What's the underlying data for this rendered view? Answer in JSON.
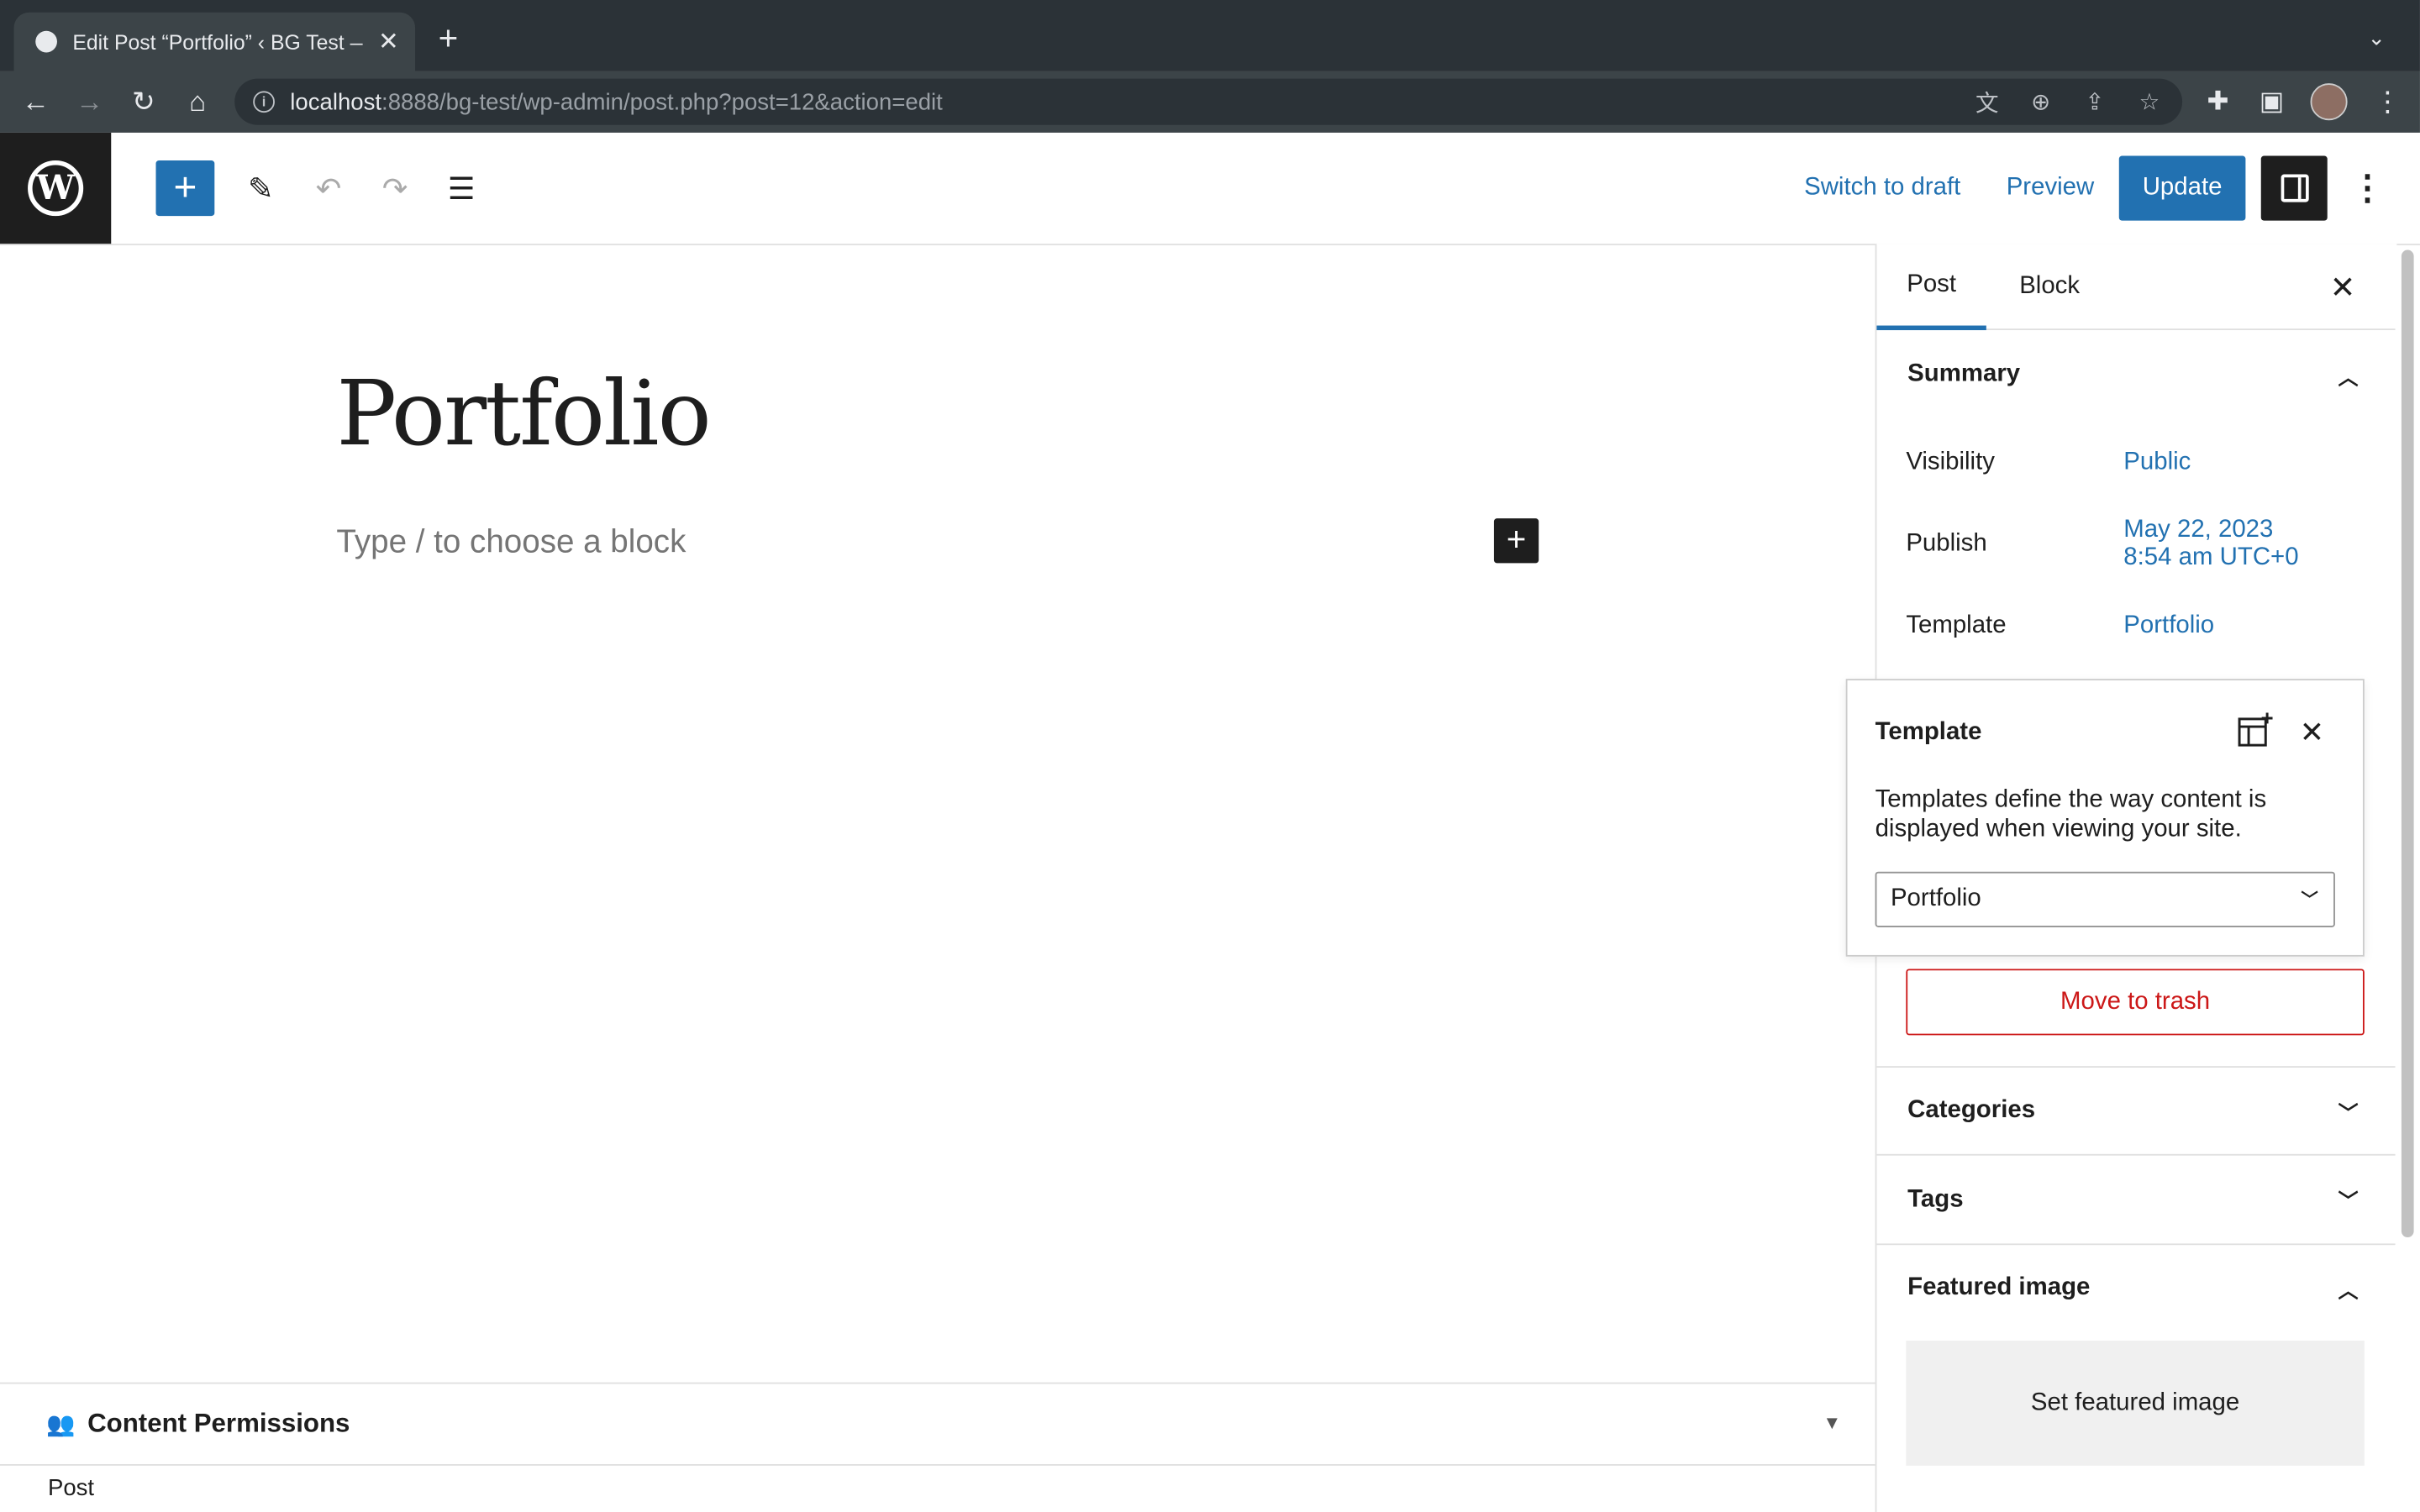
{
  "browser": {
    "tab_title": "Edit Post “Portfolio” ‹ BG Test — WordPress",
    "new_tab_icon": "plus-icon",
    "url_host": "localhost",
    "url_rest": ":8888/bg-test/wp-admin/post.php?post=12&action=edit"
  },
  "header": {
    "switch_to_draft": "Switch to draft",
    "preview": "Preview",
    "update": "Update"
  },
  "editor": {
    "post_title": "Portfolio",
    "block_placeholder": "Type / to choose a block"
  },
  "metabox": {
    "title": "Content Permissions"
  },
  "footer": {
    "breadcrumb": "Post"
  },
  "sidebar": {
    "tabs": [
      {
        "label": "Post"
      },
      {
        "label": "Block"
      }
    ],
    "summary": {
      "title": "Summary",
      "visibility_label": "Visibility",
      "visibility_value": "Public",
      "publish_label": "Publish",
      "publish_date": "May 22, 2023",
      "publish_time": "8:54 am UTC+0",
      "template_label": "Template",
      "template_value": "Portfolio",
      "trash": "Move to trash"
    },
    "categories": "Categories",
    "tags": "Tags",
    "featured_image": {
      "title": "Featured image",
      "set": "Set featured image"
    }
  },
  "template_popover": {
    "title": "Template",
    "description": "Templates define the way content is displayed when viewing your site.",
    "selected": "Portfolio"
  },
  "colors": {
    "accent": "#2271b1",
    "danger": "#cc1818",
    "dark": "#1e1e1e"
  }
}
